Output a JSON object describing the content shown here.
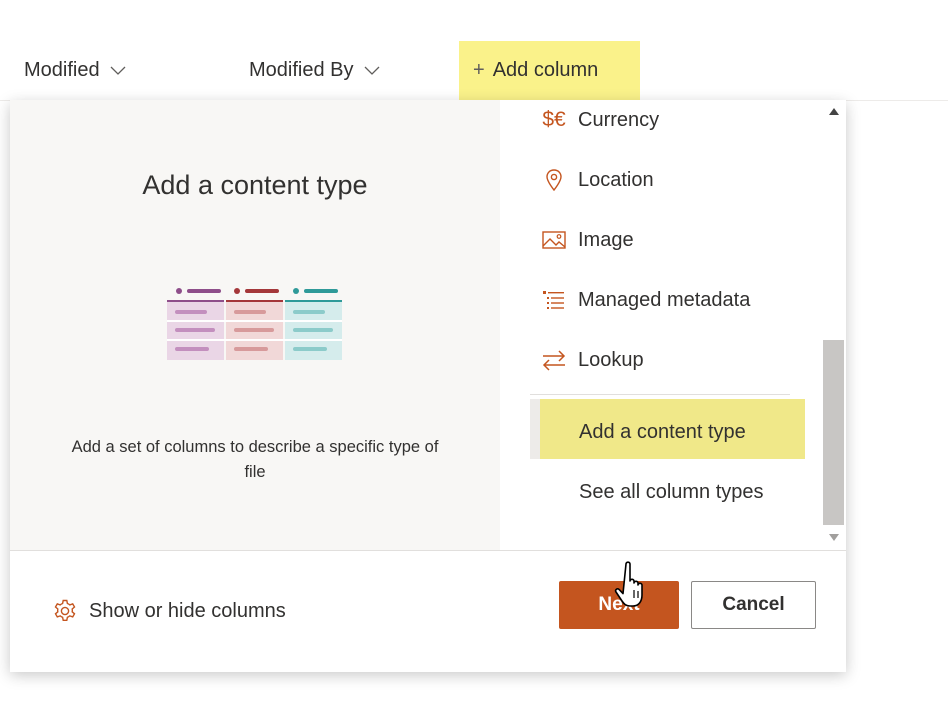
{
  "header": {
    "columns": [
      {
        "label": "Modified",
        "icon": "chevron-down-icon"
      },
      {
        "label": "Modified By",
        "icon": "chevron-down-icon"
      }
    ],
    "add_column": {
      "label": "Add column",
      "icon": "plus-icon"
    }
  },
  "panel": {
    "preview": {
      "title": "Add a content type",
      "description": "Add a set of columns to describe a specific type of file",
      "illustration": "content-type-table-illustration"
    },
    "menu_items": [
      {
        "label": "Currency",
        "icon": "currency-icon"
      },
      {
        "label": "Location",
        "icon": "location-pin-icon"
      },
      {
        "label": "Image",
        "icon": "image-icon"
      },
      {
        "label": "Managed metadata",
        "icon": "managed-metadata-icon"
      },
      {
        "label": "Lookup",
        "icon": "lookup-arrows-icon"
      },
      {
        "label": "Add a content type",
        "selected": true
      },
      {
        "label": "See all column types"
      }
    ],
    "footer": {
      "show_hide_label": "Show or hide columns",
      "next_label": "Next",
      "cancel_label": "Cancel"
    }
  },
  "colors": {
    "accent": "#c4551f",
    "highlight": "#faf28a",
    "selected_highlight": "#f0e889",
    "text": "#323130"
  }
}
